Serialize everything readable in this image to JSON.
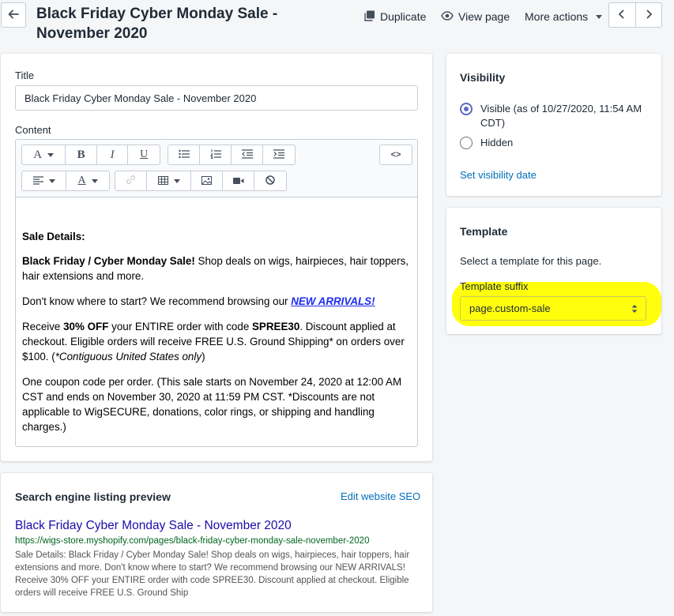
{
  "header": {
    "title": "Black Friday Cyber Monday Sale - November 2020",
    "duplicate_label": "Duplicate",
    "view_label": "View page",
    "more_label": "More actions"
  },
  "form": {
    "title_label": "Title",
    "title_value": "Black Friday Cyber Monday Sale - November 2020",
    "content_label": "Content"
  },
  "toolbar": {
    "font_label": "A",
    "bold_label": "B",
    "italic_label": "I",
    "underline_label": "U",
    "html_label": "<>"
  },
  "content": {
    "heading": "Sale Details:",
    "p1_bold": "Black Friday / Cyber Monday Sale!",
    "p1_rest": " Shop deals on wigs, hairpieces, hair toppers, hair extensions and more.",
    "p2_text": "Don't know where to start? We recommend browsing our ",
    "p2_link": "NEW ARRIVALS!",
    "p3_a": "Receive ",
    "p3_b": "30% OFF",
    "p3_c": " your ENTIRE order with code ",
    "p3_d": "SPREE30",
    "p3_e": ". Discount applied at checkout. Eligible orders will receive FREE U.S. Ground Shipping* on orders over $100. (",
    "p3_f": "*Contiguous United States only",
    "p3_g": ")",
    "p4": "One coupon code per order. (This sale starts on November 24, 2020 at 12:00 AM CST and ends on November 30, 2020 at 11:59 PM CST. *Discounts are not applicable to WigSECURE, donations, color rings, or shipping and handling charges.)"
  },
  "seo": {
    "heading": "Search engine listing preview",
    "edit_link": "Edit website SEO",
    "preview_title": "Black Friday Cyber Monday Sale - November 2020",
    "preview_url": "https://wigs-store.myshopify.com/pages/black-friday-cyber-monday-sale-november-2020",
    "preview_desc": "Sale Details: Black Friday / Cyber Monday Sale! Shop deals on wigs, hairpieces, hair toppers, hair extensions and more. Don't know where to start? We recommend browsing our NEW ARRIVALS! Receive 30% OFF your ENTIRE order with code SPREE30. Discount applied at checkout. Eligible orders will receive FREE U.S. Ground Ship"
  },
  "visibility": {
    "heading": "Visibility",
    "visible_label": "Visible (as of 10/27/2020, 11:54 AM CDT)",
    "hidden_label": "Hidden",
    "selected": "visible",
    "set_date_link": "Set visibility date"
  },
  "template": {
    "heading": "Template",
    "description": "Select a template for this page.",
    "suffix_label": "Template suffix",
    "suffix_value": "page.custom-sale",
    "highlight_color": "#ffff00"
  },
  "colors": {
    "accent": "#5c6ac4",
    "link": "#006fbb",
    "seo_title": "#1a0dab",
    "seo_url": "#006621"
  }
}
